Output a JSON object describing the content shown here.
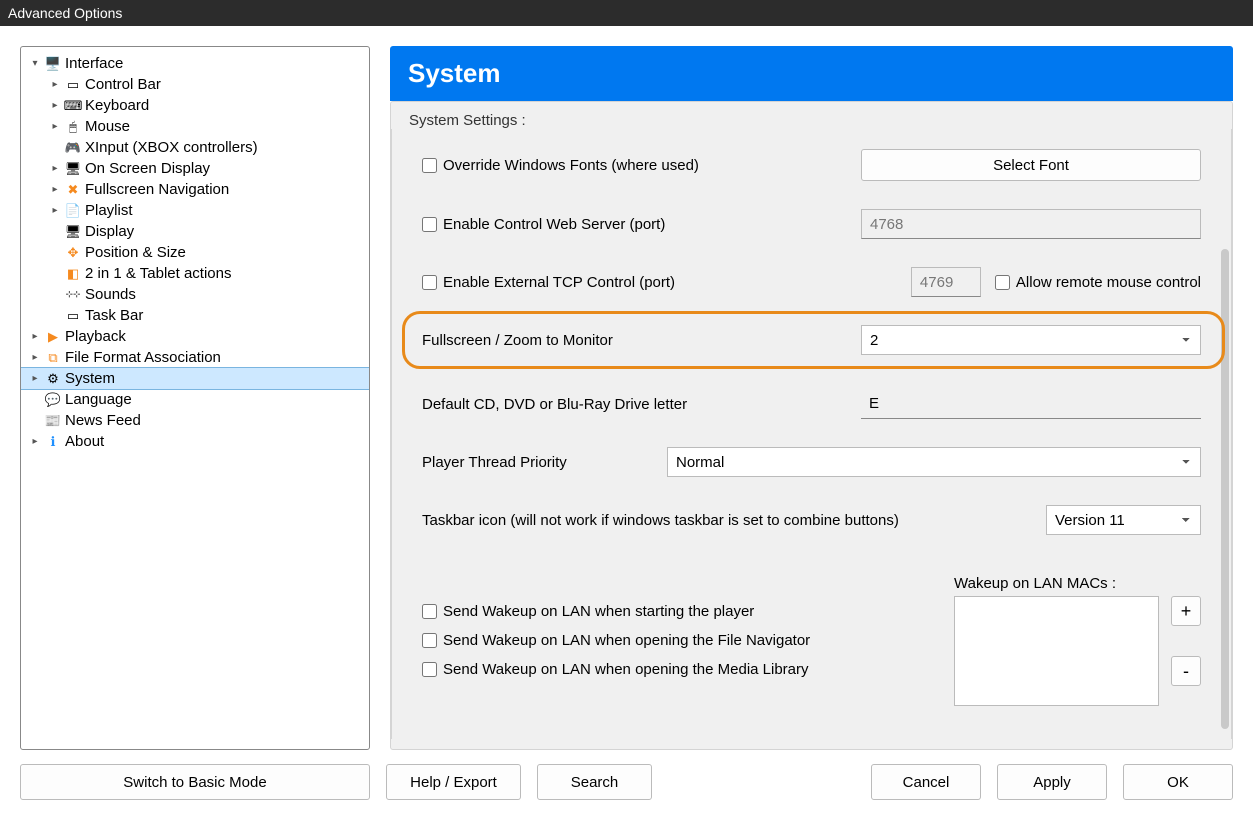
{
  "window": {
    "title": "Advanced Options"
  },
  "tree": {
    "interface": "Interface",
    "control_bar": "Control Bar",
    "keyboard": "Keyboard",
    "mouse": "Mouse",
    "xinput": "XInput (XBOX controllers)",
    "osd": "On Screen Display",
    "fullscreen_nav": "Fullscreen Navigation",
    "playlist": "Playlist",
    "display": "Display",
    "pos_size": "Position & Size",
    "two_in_one": "2 in 1 & Tablet actions",
    "sounds": "Sounds",
    "task_bar": "Task Bar",
    "playback": "Playback",
    "file_format": "File Format Association",
    "system": "System",
    "language": "Language",
    "news_feed": "News Feed",
    "about": "About"
  },
  "header": {
    "title": "System"
  },
  "fieldset": {
    "label": "System Settings :"
  },
  "settings": {
    "override_fonts": "Override Windows Fonts (where used)",
    "select_font_btn": "Select Font",
    "enable_web_server": "Enable Control Web Server (port)",
    "web_port": "4768",
    "enable_tcp": "Enable External TCP Control (port)",
    "tcp_port": "4769",
    "allow_remote_mouse": "Allow remote mouse control",
    "fullscreen_monitor_label": "Fullscreen / Zoom to Monitor",
    "fullscreen_monitor_value": "2",
    "drive_letter_label": "Default CD, DVD or Blu-Ray Drive letter",
    "drive_letter_value": "E",
    "thread_priority_label": "Player Thread Priority",
    "thread_priority_value": "Normal",
    "taskbar_icon_label": "Taskbar icon (will not work if windows taskbar is set to combine buttons)",
    "taskbar_icon_value": "Version 11",
    "wol_label": "Wakeup on LAN MACs :",
    "wol_start": "Send Wakeup on LAN when starting the player",
    "wol_filenav": "Send Wakeup on LAN when opening the File Navigator",
    "wol_medialib": "Send Wakeup on LAN when opening the Media Library",
    "wol_add": "+",
    "wol_remove": "-"
  },
  "buttons": {
    "switch_basic": "Switch to Basic Mode",
    "help_export": "Help / Export",
    "search": "Search",
    "cancel": "Cancel",
    "apply": "Apply",
    "ok": "OK"
  }
}
